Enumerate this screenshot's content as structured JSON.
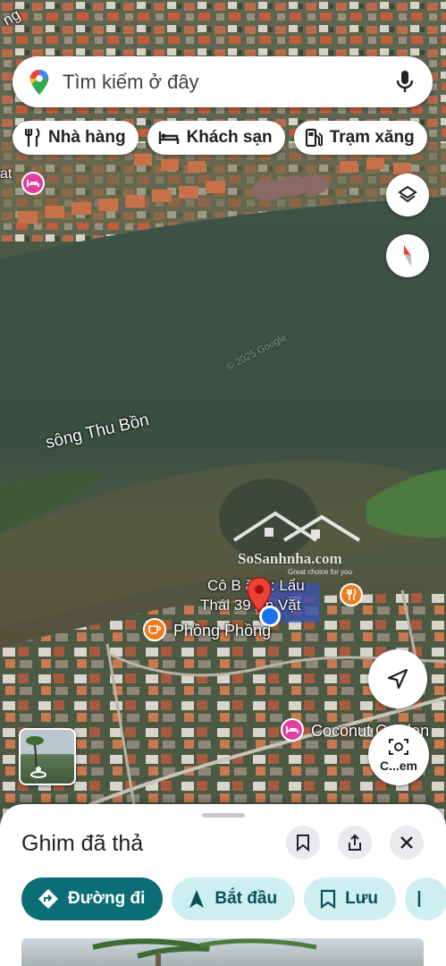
{
  "search": {
    "placeholder": "Tìm kiếm ở đây"
  },
  "chips": [
    {
      "label": "Nhà hàng",
      "icon": "restaurant-icon"
    },
    {
      "label": "Khách sạn",
      "icon": "hotel-icon"
    },
    {
      "label": "Trạm xăng",
      "icon": "gas-station-icon"
    }
  ],
  "map": {
    "river_label": "sông Thu Bồn",
    "watermark_brand": "SoSanhnha.com",
    "watermark_tagline": "Great choice for you",
    "copyright": "© 2025 Google",
    "places": {
      "restaurant_line1": "Cô B    ăng: Lẩu",
      "restaurant_line2": "Thái 39  Ăn Vặt",
      "cafe": "Phồng Phồng",
      "hotel": "Coconut Garden",
      "left_edge": "at"
    },
    "top_left_fragment": "ng",
    "street_view_button": "C...em"
  },
  "sheet": {
    "title": "Ghim đã thả",
    "actions": [
      {
        "label": "Đường đi",
        "icon": "directions-icon"
      },
      {
        "label": "Bắt đầu",
        "icon": "navigation-arrow-icon"
      },
      {
        "label": "Lưu",
        "icon": "bookmark-icon"
      }
    ]
  },
  "colors": {
    "primary_action": "#0b6e74",
    "secondary_action": "#cdeff2",
    "pin_red": "#ea4335",
    "location_blue": "#1a73e8",
    "hotel_poi": "#e040a0",
    "food_poi": "#f07c1e"
  }
}
